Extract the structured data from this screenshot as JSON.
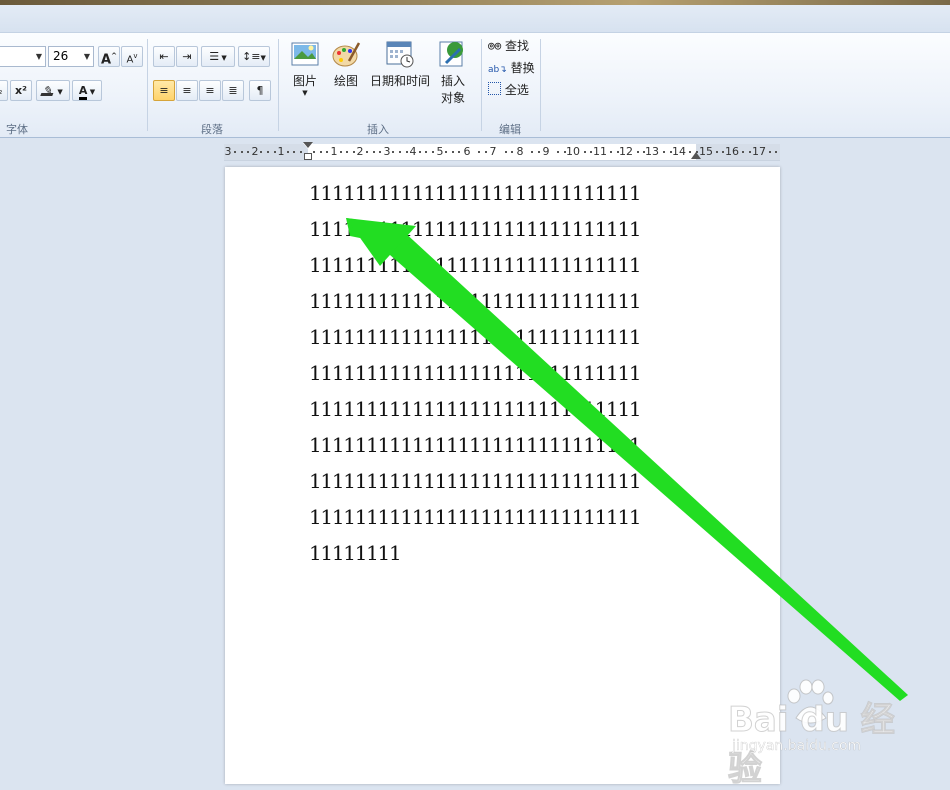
{
  "ribbon": {
    "font_group": {
      "label": "字体",
      "font_size": "26",
      "grow_font": "A",
      "shrink_font": "A",
      "superscript": "x²",
      "font_color_letter": "A"
    },
    "paragraph_group": {
      "label": "段落"
    },
    "insert_group": {
      "label": "插入",
      "picture": "图片",
      "drawing": "绘图",
      "datetime": "日期和时间",
      "object_line1": "插入",
      "object_line2": "对象"
    },
    "edit_group": {
      "label": "编辑",
      "find": "查找",
      "replace": "替换",
      "select_all": "全选"
    }
  },
  "ruler": {
    "labels": [
      "3",
      "2",
      "1",
      "1",
      "2",
      "3",
      "4",
      "5",
      "6",
      "7",
      "8",
      "9",
      "10",
      "11",
      "12",
      "13",
      "14",
      "15",
      "16",
      "17"
    ]
  },
  "document": {
    "lines": [
      "11111111111111111111111111111",
      "11111111111111111111111111111",
      "11111111111111111111111111111",
      "11111111111111111111111111111",
      "11111111111111111111111111111",
      "11111111111111111111111111111",
      "11111111111111111111111111111",
      "11111111111111111111111111111",
      "11111111111111111111111111111",
      "11111111111111111111111111111",
      "11111111"
    ]
  },
  "watermark": {
    "brand": "Bai du 经验",
    "url": "jingyan.baidu.com"
  },
  "colors": {
    "annotation_arrow": "#22dd22",
    "active_align": "#ffd36b"
  }
}
